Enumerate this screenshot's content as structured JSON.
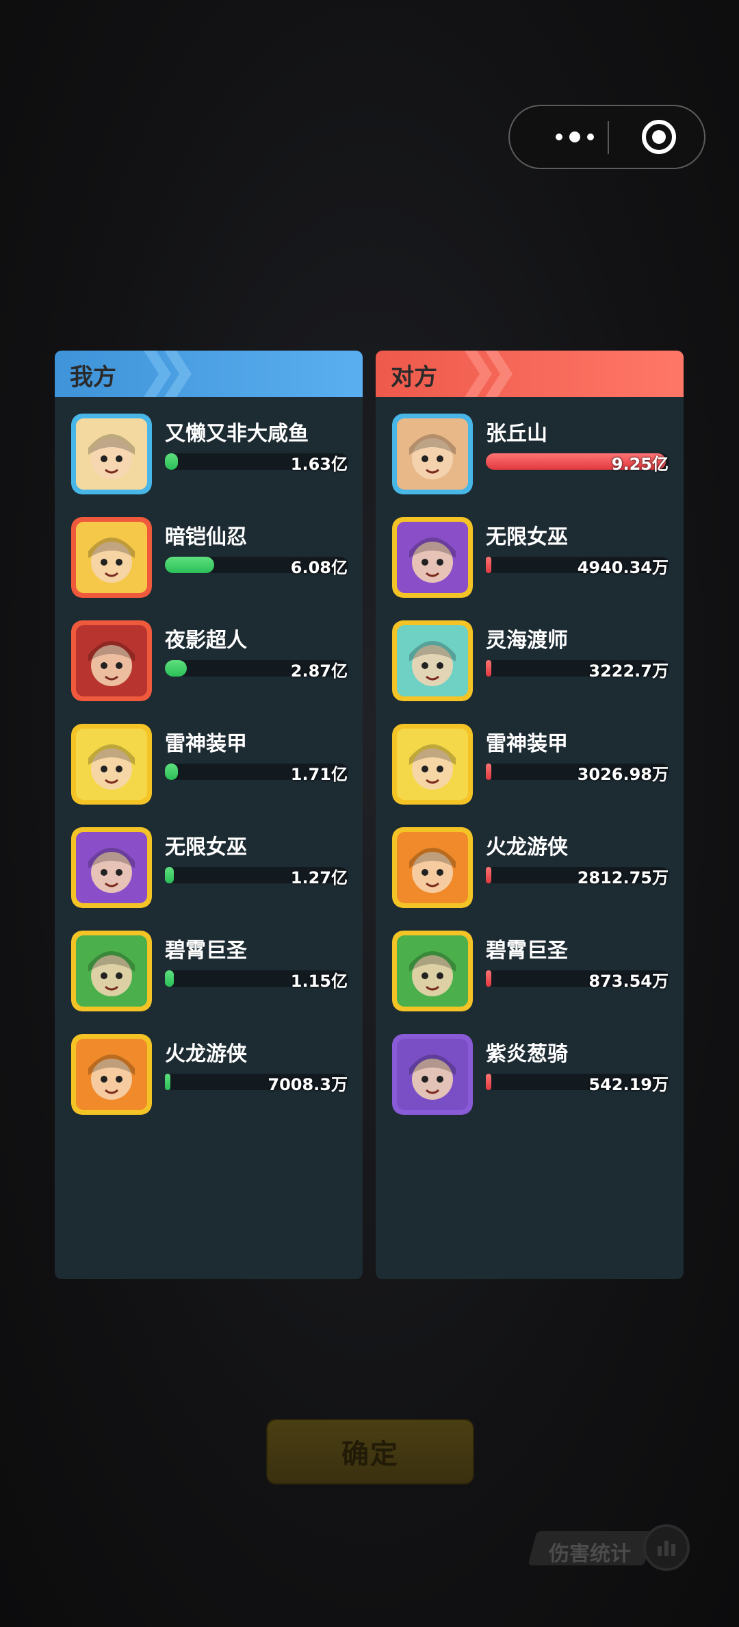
{
  "capsule": {
    "more_icon": "more-dots-icon",
    "close_icon": "target-circle-icon"
  },
  "left_panel": {
    "title": "我方",
    "color": "#5aaff0",
    "players": [
      {
        "name": "又懒又非大咸鱼",
        "value": "1.63亿",
        "fraction": 0.07,
        "frame": "#48b6e6",
        "tone": "#f3d9a0",
        "icon": "straw-hat-farmer-avatar"
      },
      {
        "name": "暗铠仙忍",
        "value": "6.08亿",
        "fraction": 0.27,
        "frame": "#ef5a3c",
        "tone": "#f5c84a",
        "icon": "dark-armor-ninja-avatar"
      },
      {
        "name": "夜影超人",
        "value": "2.87亿",
        "fraction": 0.12,
        "frame": "#ef5a3c",
        "tone": "#b8342e",
        "icon": "night-shadow-hero-avatar"
      },
      {
        "name": "雷神装甲",
        "value": "1.71亿",
        "fraction": 0.07,
        "frame": "#f4c326",
        "tone": "#f5d84a",
        "icon": "thunder-armor-avatar"
      },
      {
        "name": "无限女巫",
        "value": "1.27亿",
        "fraction": 0.05,
        "frame": "#f4c326",
        "tone": "#8a4fc8",
        "icon": "infinity-witch-avatar"
      },
      {
        "name": "碧霄巨圣",
        "value": "1.15亿",
        "fraction": 0.05,
        "frame": "#f4c326",
        "tone": "#4bb04b",
        "icon": "jade-giant-saint-avatar"
      },
      {
        "name": "火龙游侠",
        "value": "7008.3万",
        "fraction": 0.02,
        "frame": "#f4c326",
        "tone": "#f08a2a",
        "icon": "fire-dragon-ranger-avatar"
      }
    ]
  },
  "right_panel": {
    "title": "对方",
    "color": "#ff7767",
    "players": [
      {
        "name": "张丘山",
        "value": "9.25亿",
        "fraction": 0.98,
        "frame": "#48b6e6",
        "tone": "#e8b889",
        "icon": "zhang-qiushan-avatar"
      },
      {
        "name": "无限女巫",
        "value": "4940.34万",
        "fraction": 0.02,
        "frame": "#f4c326",
        "tone": "#8a4fc8",
        "icon": "infinity-witch-avatar"
      },
      {
        "name": "灵海渡师",
        "value": "3222.7万",
        "fraction": 0.015,
        "frame": "#f4c326",
        "tone": "#6fd0c4",
        "icon": "spirit-sea-master-avatar"
      },
      {
        "name": "雷神装甲",
        "value": "3026.98万",
        "fraction": 0.015,
        "frame": "#f4c326",
        "tone": "#f5d84a",
        "icon": "thunder-armor-avatar"
      },
      {
        "name": "火龙游侠",
        "value": "2812.75万",
        "fraction": 0.015,
        "frame": "#f4c326",
        "tone": "#f08a2a",
        "icon": "fire-dragon-ranger-avatar"
      },
      {
        "name": "碧霄巨圣",
        "value": "873.54万",
        "fraction": 0.005,
        "frame": "#f4c326",
        "tone": "#4bb04b",
        "icon": "jade-giant-saint-avatar"
      },
      {
        "name": "紫炎葱骑",
        "value": "542.19万",
        "fraction": 0.003,
        "frame": "#8a5bd6",
        "tone": "#7a4fc6",
        "icon": "purple-flame-knight-avatar"
      }
    ]
  },
  "confirm_label": "确定",
  "damage_stats_label": "伤害统计"
}
